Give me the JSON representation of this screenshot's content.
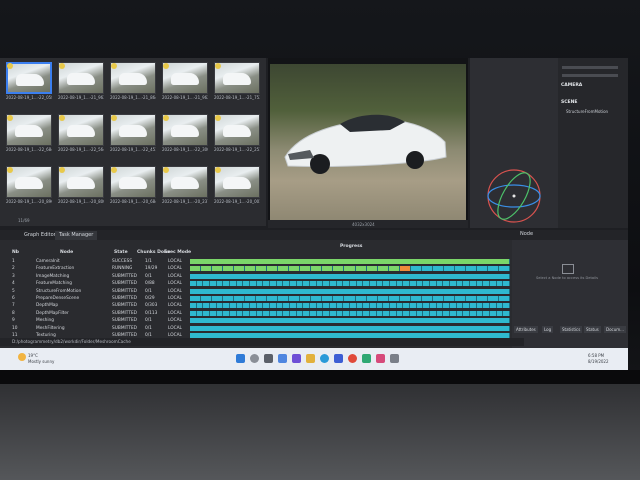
{
  "gallery": {
    "thumbnails": [
      "2022-08-19_1...-22_058.jpeg",
      "2022-08-19_1...-21_963.jpeg",
      "2022-08-19_1...-21_864.jpeg",
      "2022-08-19_1...-21_962.jpeg",
      "2022-08-19_1...-21_753.jpeg",
      "2022-08-19_1...-22_684.jpeg",
      "2022-08-19_1...-22_564.jpeg",
      "2022-08-19_1...-22_451.jpeg",
      "2022-08-19_1...-22_300.jpeg",
      "2022-08-19_1...-22_251.jpeg",
      "2022-08-19_1...-20_896.jpeg",
      "2022-08-19_1...-20_800.jpeg",
      "2022-08-19_1...-20_684.jpeg",
      "2022-08-19_1...-20_237.jpeg",
      "2022-08-19_1...-20_001.jpeg"
    ],
    "count_label": "11/69"
  },
  "viewer": {
    "status": "4032x3024"
  },
  "inspector": {
    "camera_label": "CAMERA",
    "scene_label": "SCENE",
    "scene_item": "StructureFromMotion"
  },
  "tabs": {
    "graph_editor": "Graph Editor",
    "task_manager": "Task Manager"
  },
  "task_manager": {
    "headers": {
      "nb": "Nb",
      "node": "Node",
      "state": "State",
      "chunks": "Chunks Done",
      "exec": "Exec Mode",
      "progress": "Progress"
    },
    "rows": [
      {
        "nb": "1",
        "node": "CameraInit",
        "state": "SUCCESS",
        "chunks": "1/1",
        "exec": "LOCAL"
      },
      {
        "nb": "2",
        "node": "FeatureExtraction",
        "state": "RUNNING",
        "chunks": "19/29",
        "exec": "LOCAL"
      },
      {
        "nb": "3",
        "node": "ImageMatching",
        "state": "SUBMITTED",
        "chunks": "0/1",
        "exec": "LOCAL"
      },
      {
        "nb": "4",
        "node": "FeatureMatching",
        "state": "SUBMITTED",
        "chunks": "0/88",
        "exec": "LOCAL"
      },
      {
        "nb": "5",
        "node": "StructureFromMotion",
        "state": "SUBMITTED",
        "chunks": "0/1",
        "exec": "LOCAL"
      },
      {
        "nb": "6",
        "node": "PrepareDenseScene",
        "state": "SUBMITTED",
        "chunks": "0/29",
        "exec": "LOCAL"
      },
      {
        "nb": "7",
        "node": "DepthMap",
        "state": "SUBMITTED",
        "chunks": "0/303",
        "exec": "LOCAL"
      },
      {
        "nb": "8",
        "node": "DepthMapFilter",
        "state": "SUBMITTED",
        "chunks": "0/113",
        "exec": "LOCAL"
      },
      {
        "nb": "9",
        "node": "Meshing",
        "state": "SUBMITTED",
        "chunks": "0/1",
        "exec": "LOCAL"
      },
      {
        "nb": "10",
        "node": "MeshFiltering",
        "state": "SUBMITTED",
        "chunks": "0/1",
        "exec": "LOCAL"
      },
      {
        "nb": "11",
        "node": "Texturing",
        "state": "SUBMITTED",
        "chunks": "0/1",
        "exec": "LOCAL"
      }
    ],
    "segments": [
      1,
      29,
      1,
      88,
      1,
      29,
      303,
      113,
      1,
      1,
      1
    ],
    "done": [
      1,
      19,
      0,
      0,
      0,
      0,
      0,
      0,
      0,
      0,
      0
    ]
  },
  "node_panel": {
    "title": "Node",
    "hint": "Select a Node to access its Details",
    "buttons": [
      "Attributes",
      "Log",
      "Statistics",
      "Status",
      "Docum..."
    ]
  },
  "pathbar": {
    "path": "D:/photogrammetry/db2/workdir/Folder/MeshroomCache"
  },
  "taskbar": {
    "weather_temp": "19°C",
    "weather_desc": "Mostly sunny",
    "time": "6:58 PM",
    "date": "8/19/2022"
  },
  "colors": {
    "accent": "#3b7ff0",
    "progress": "#2fb9cf",
    "done": "#7bd66a",
    "running": "#ee8a3a"
  }
}
